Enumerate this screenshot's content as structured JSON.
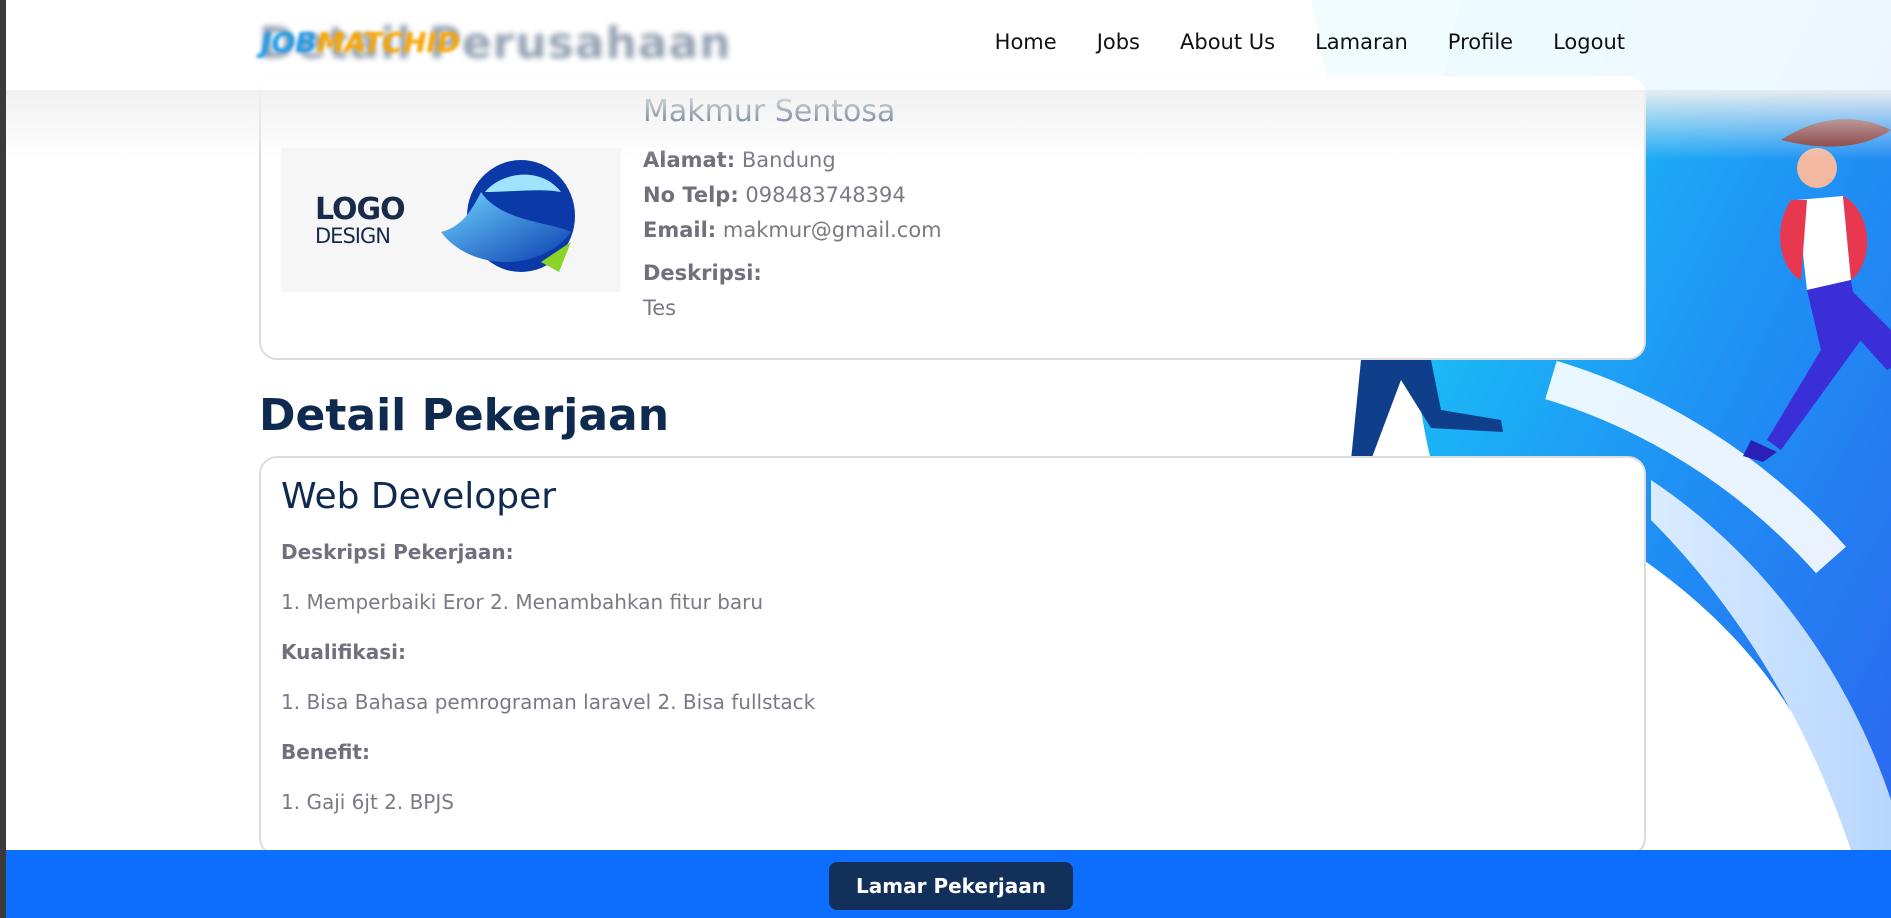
{
  "navbar": {
    "brand_text": "Detail Perusahaan",
    "brand_logo": {
      "job": "JOB",
      "match": "MATCH",
      "id": "ID"
    },
    "links": [
      "Home",
      "Jobs",
      "About Us",
      "Lamaran",
      "Profile",
      "Logout"
    ]
  },
  "company": {
    "logo": {
      "main": "LOGO",
      "sub": "DESIGN"
    },
    "name": "Makmur Sentosa",
    "address_label": "Alamat:",
    "address": "Bandung",
    "phone_label": "No Telp:",
    "phone": "098483748394",
    "email_label": "Email:",
    "email": "makmur@gmail.com",
    "description_label": "Deskripsi:",
    "description": "Tes"
  },
  "section_title": "Detail Pekerjaan",
  "job": {
    "title": "Web Developer",
    "description_label": "Deskripsi Pekerjaan:",
    "description": "1. Memperbaiki Eror 2. Menambahkan fitur baru",
    "qualification_label": "Kualifikasi:",
    "qualification": "1. Bisa Bahasa pemrograman laravel 2. Bisa fullstack",
    "benefit_label": "Benefit:",
    "benefit": "1. Gaji 6jt 2. BPJS"
  },
  "actions": {
    "apply_label": "Lamar Pekerjaan"
  },
  "colors": {
    "primary": "#0d6efd",
    "navy": "#12305a",
    "heading": "#0f2a4f",
    "hero_cyan": "#19c6f5"
  }
}
